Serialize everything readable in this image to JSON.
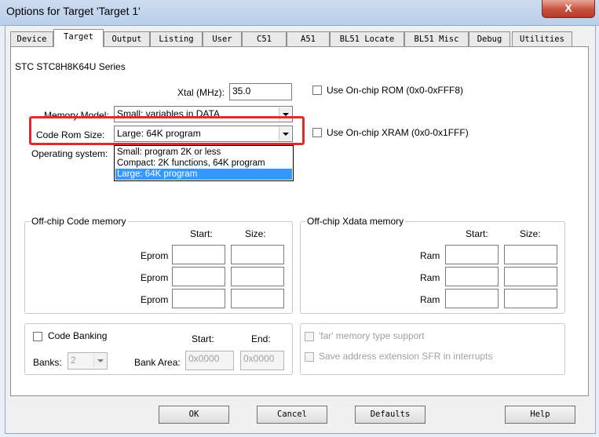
{
  "window": {
    "title": "Options for Target 'Target 1'",
    "close": "X"
  },
  "tabs": [
    "Device",
    "Target",
    "Output",
    "Listing",
    "User",
    "C51",
    "A51",
    "BL51 Locate",
    "BL51 Misc",
    "Debug",
    "Utilities"
  ],
  "device_series": "STC STC8H8K64U Series",
  "xtal": {
    "label": "Xtal (MHz):",
    "value": "35.0"
  },
  "onchip_rom_label": "Use On-chip ROM (0x0-0xFFF8)",
  "onchip_xram_label": "Use On-chip XRAM (0x0-0x1FFF)",
  "memory_model": {
    "label": "Memory Model:",
    "value": "Small: variables in DATA"
  },
  "code_rom": {
    "label": "Code Rom Size:",
    "value": "Large: 64K program",
    "options": [
      "Small: program 2K or less",
      "Compact: 2K functions, 64K program",
      "Large: 64K program"
    ]
  },
  "os_label": "Operating system:",
  "code_memory": {
    "title": "Off-chip Code memory",
    "start": "Start:",
    "size": "Size:",
    "row_label": "Eprom"
  },
  "xdata_memory": {
    "title": "Off-chip Xdata memory",
    "start": "Start:",
    "size": "Size:",
    "row_label": "Ram"
  },
  "banking": {
    "label": "Code Banking",
    "start": "Start:",
    "end": "End:",
    "banks_label": "Banks:",
    "banks_value": "2",
    "area_label": "Bank Area:",
    "area_start": "0x0000",
    "area_end": "0x0000"
  },
  "far_label": "'far' memory type support",
  "save_ext_label": "Save address extension SFR in interrupts",
  "buttons": {
    "ok": "OK",
    "cancel": "Cancel",
    "defaults": "Defaults",
    "help": "Help"
  }
}
